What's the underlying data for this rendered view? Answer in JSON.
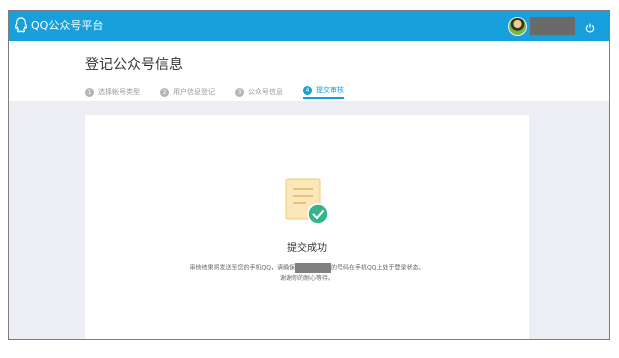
{
  "app": {
    "brand": "QQ公众号平台",
    "accent": "#17a0dc"
  },
  "header": {
    "title": "登记公众号信息"
  },
  "steps": [
    {
      "num": "1",
      "label": "选择帐号类型"
    },
    {
      "num": "2",
      "label": "用户信息登记"
    },
    {
      "num": "3",
      "label": "公众号信息"
    },
    {
      "num": "4",
      "label": "提交审核"
    }
  ],
  "active_step": 4,
  "result": {
    "title": "提交成功",
    "message_before": "审核结果将发送至您的手机QQ，请确保",
    "message_after": "的号码在手机QQ上处于登录状态。",
    "message_line2": "谢谢你的耐心等待。"
  },
  "icons": [
    "qq-logo-icon",
    "avatar",
    "power-icon",
    "document-check-icon"
  ]
}
